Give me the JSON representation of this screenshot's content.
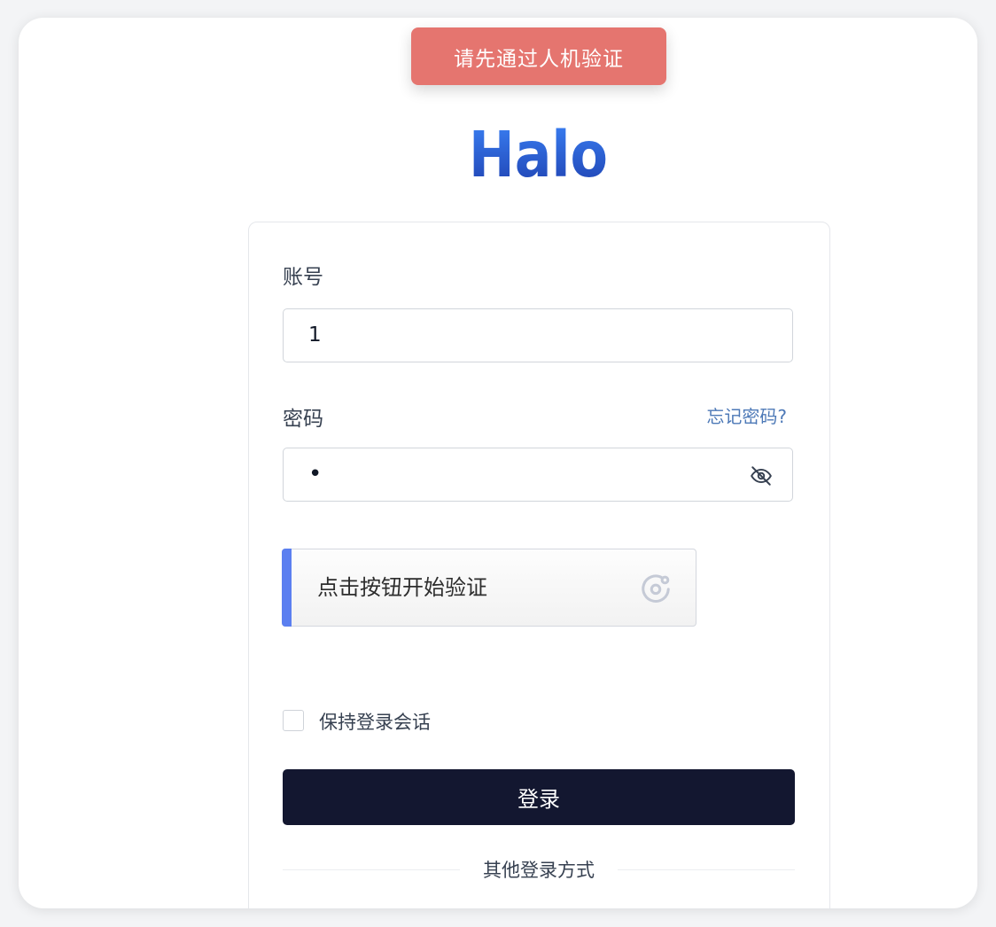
{
  "toast": {
    "message": "请先通过人机验证"
  },
  "logo": {
    "text": "Halo",
    "color_start": "#3b82f6",
    "color_end": "#1e40af"
  },
  "form": {
    "username_label": "账号",
    "username_value": "1",
    "password_label": "密码",
    "forgot_link": "忘记密码?",
    "password_value": "•",
    "password_toggle_icon": "eye-off-icon",
    "captcha_label": "点击按钮开始验证",
    "captcha_icon": "captcha-icon",
    "remember_label": "保持登录会话",
    "remember_checked": false,
    "login_button": "登录",
    "other_methods": "其他登录方式"
  },
  "colors": {
    "toast_bg": "#e5756f",
    "login_button_bg": "#131730",
    "link": "#4d79b7",
    "captcha_accent": "#5b7ff0"
  }
}
